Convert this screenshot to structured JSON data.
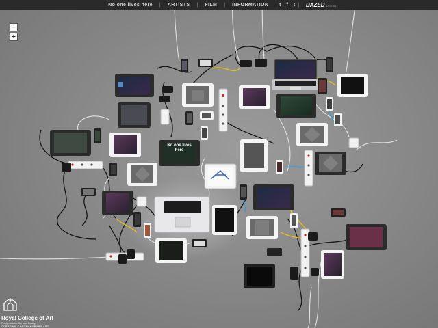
{
  "nav": {
    "item1": "No one lives here",
    "item2": "ARTISTS",
    "item3": "FILM",
    "item4": "INFORMATION",
    "separator": "|",
    "social1": "t",
    "social2": "f",
    "social3": "t",
    "brand": "DAZED",
    "brand_sub": "DIGITAL"
  },
  "zoom": {
    "minus": "−",
    "plus": "+"
  },
  "screen_caption": "No one lives here",
  "logo": {
    "name": "Royal College of Art",
    "subtitle": "Postgraduate Art and Design",
    "tagline": "CURATING CONTEMPORARY ART"
  },
  "colors": {
    "bar": "#2a2a2a",
    "cable_black": "#111111",
    "cable_white": "#f0f0f0",
    "cable_yellow": "#e6c21a",
    "cable_blue": "#3aa0d8",
    "cable_red": "#c0392b"
  }
}
